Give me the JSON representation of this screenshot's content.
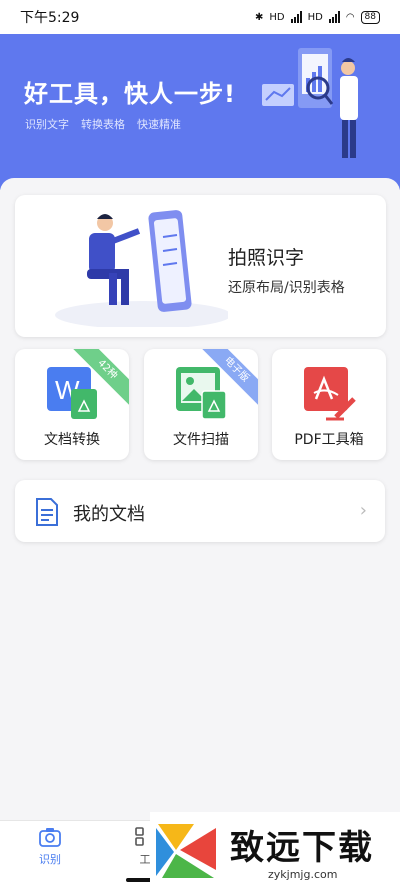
{
  "status": {
    "time": "下午5:29",
    "battery": "88",
    "net1": "HD",
    "net2": "HD"
  },
  "hero": {
    "title": "好工具，快人一步!",
    "tags": [
      "识别文字",
      "转换表格",
      "快速精准"
    ]
  },
  "photo_card": {
    "title": "拍照识字",
    "subtitle": "还原布局/识别表格"
  },
  "tools": [
    {
      "label": "文档转换",
      "badge": "42种",
      "badge_color": "#6fcf8a"
    },
    {
      "label": "文件扫描",
      "badge": "电子版",
      "badge_color": "#8aa9f4"
    },
    {
      "label": "PDF工具箱"
    }
  ],
  "docs": {
    "label": "我的文档"
  },
  "nav": {
    "tab1": "识别",
    "tab2": "工"
  },
  "watermark": {
    "brand": "致远下载",
    "url": "zykjmjg.com"
  },
  "colors": {
    "accent": "#5f78ee",
    "nav_active": "#4a7df0"
  }
}
